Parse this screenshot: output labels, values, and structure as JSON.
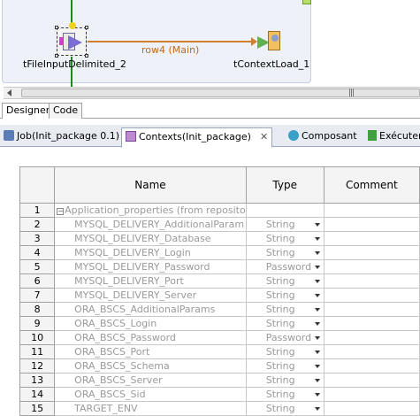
{
  "canvas": {
    "component1_label": "tFileInputDelimited_2",
    "component2_label": "tContextLoad_1",
    "flow_label": "row4 (Main)",
    "scroll_grip": "|||"
  },
  "editor_tabs": {
    "designer": "Designer",
    "code": "Code"
  },
  "view_tabs": [
    {
      "label": "Job(Init_package 0.1)",
      "icon": "job-icon"
    },
    {
      "label": "Contexts(Init_package)",
      "icon": "contexts-icon",
      "close": "✕"
    },
    {
      "label": "Composant",
      "icon": "component-icon"
    },
    {
      "label": "Exécuter",
      "icon": "run-icon"
    }
  ],
  "grid": {
    "headers": {
      "num": "",
      "name": "Name",
      "type": "Type",
      "comment": "Comment"
    },
    "rows": [
      {
        "num": "1",
        "name": "Application_properties (from reposito",
        "type": "",
        "group": true
      },
      {
        "num": "2",
        "name": "MYSQL_DELIVERY_AdditionalParam",
        "type": "String"
      },
      {
        "num": "3",
        "name": "MYSQL_DELIVERY_Database",
        "type": "String"
      },
      {
        "num": "4",
        "name": "MYSQL_DELIVERY_Login",
        "type": "String"
      },
      {
        "num": "5",
        "name": "MYSQL_DELIVERY_Password",
        "type": "Password"
      },
      {
        "num": "6",
        "name": "MYSQL_DELIVERY_Port",
        "type": "String"
      },
      {
        "num": "7",
        "name": "MYSQL_DELIVERY_Server",
        "type": "String"
      },
      {
        "num": "8",
        "name": "ORA_BSCS_AdditionalParams",
        "type": "String"
      },
      {
        "num": "9",
        "name": "ORA_BSCS_Login",
        "type": "String"
      },
      {
        "num": "10",
        "name": "ORA_BSCS_Password",
        "type": "Password"
      },
      {
        "num": "11",
        "name": "ORA_BSCS_Port",
        "type": "String"
      },
      {
        "num": "12",
        "name": "ORA_BSCS_Schema",
        "type": "String"
      },
      {
        "num": "13",
        "name": "ORA_BSCS_Server",
        "type": "String"
      },
      {
        "num": "14",
        "name": "ORA_BSCS_Sid",
        "type": "String"
      },
      {
        "num": "15",
        "name": "TARGET_ENV",
        "type": "String"
      }
    ]
  }
}
